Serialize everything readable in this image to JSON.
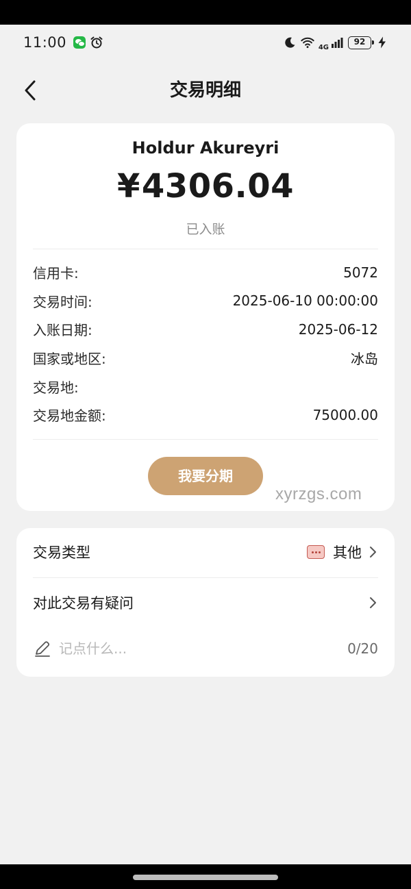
{
  "status_bar": {
    "time": "11:00",
    "network": "4G",
    "battery": "92"
  },
  "header": {
    "title": "交易明细"
  },
  "transaction": {
    "merchant": "Holdur Akureyri",
    "currency_symbol": "¥",
    "amount": "4306.04",
    "status": "已入账",
    "details": [
      {
        "label": "信用卡:",
        "value": "5072"
      },
      {
        "label": "交易时间:",
        "value": "2025-06-10 00:00:00"
      },
      {
        "label": "入账日期:",
        "value": "2025-06-12"
      },
      {
        "label": "国家或地区:",
        "value": "冰岛"
      },
      {
        "label": "交易地:",
        "value": ""
      },
      {
        "label": "交易地金额:",
        "value": "75000.00"
      }
    ],
    "installment_button": "我要分期"
  },
  "watermark": "xyrzgs.com",
  "extra": {
    "type_label": "交易类型",
    "type_value": "其他",
    "question_label": "对此交易有疑问",
    "note_placeholder": "记点什么...",
    "note_count": "0/20"
  },
  "colors": {
    "accent": "#cda373",
    "page_bg": "#f1f1f1",
    "card_bg": "#ffffff"
  }
}
